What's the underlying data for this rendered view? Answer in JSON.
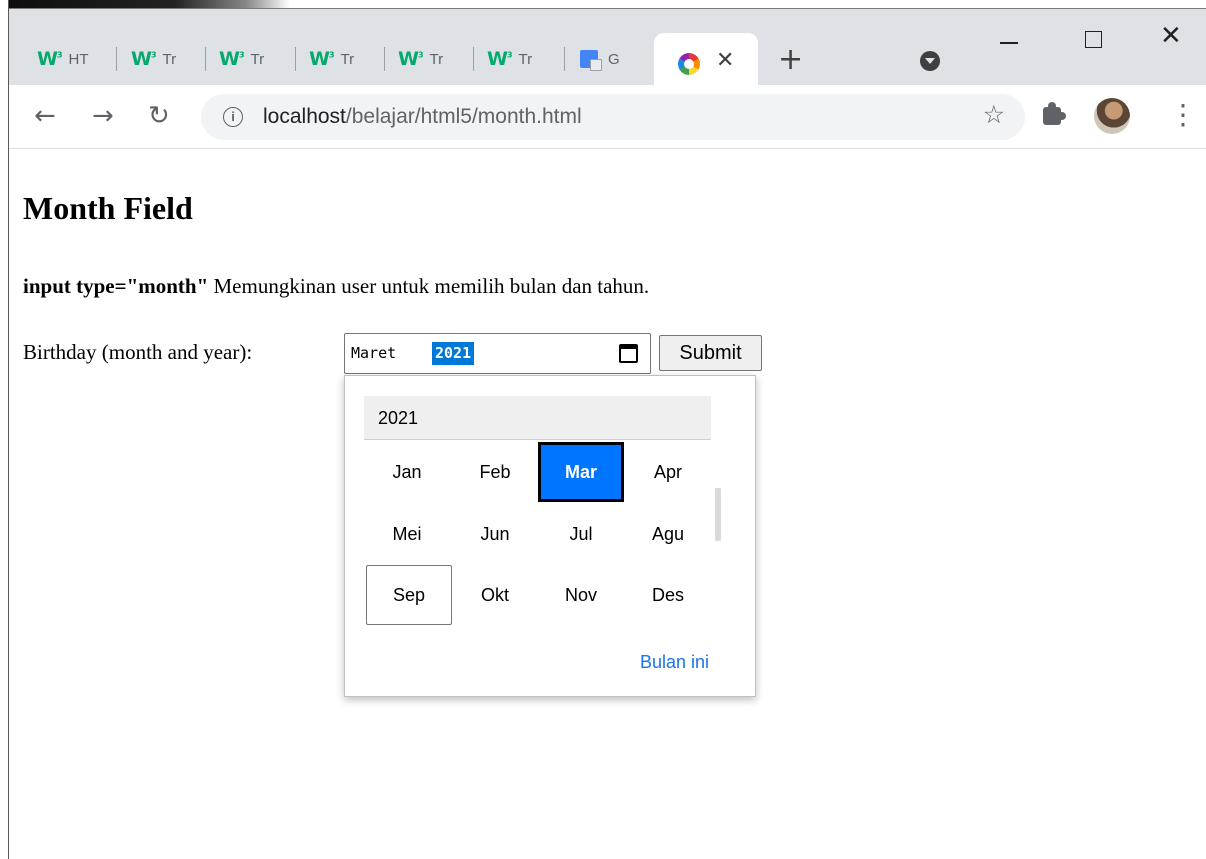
{
  "browser": {
    "tabs": [
      {
        "label": "HT"
      },
      {
        "label": "Tr"
      },
      {
        "label": "Tr"
      },
      {
        "label": "Tr"
      },
      {
        "label": "Tr"
      },
      {
        "label": "Tr"
      },
      {
        "label": "G"
      }
    ],
    "w3_mark": "W",
    "w3_sup": "3",
    "active_tab_close": "✕",
    "new_tab": "+",
    "url_host": "localhost",
    "url_path": "/belajar/html5/month.html",
    "info_glyph": "i",
    "star_glyph": "☆",
    "back_glyph": "←",
    "forward_glyph": "→",
    "reload_glyph": "↻",
    "menu_glyph": "⋮",
    "window_close_glyph": "✕"
  },
  "page": {
    "heading": "Month Field",
    "desc_bold": "input type=\"month\"",
    "desc_rest": " Memungkinan user untuk memilih bulan dan tahun.",
    "birthday_label": "Birthday (month and year):",
    "input_month": "Maret",
    "input_year": "2021",
    "submit_label": "Submit"
  },
  "picker": {
    "year": "2021",
    "months": [
      "Jan",
      "Feb",
      "Mar",
      "Apr",
      "Mei",
      "Jun",
      "Jul",
      "Agu",
      "Sep",
      "Okt",
      "Nov",
      "Des"
    ],
    "selected": "Mar",
    "current": "Sep",
    "this_month_label": "Bulan ini"
  },
  "colors": {
    "accent": "#0075ff",
    "selection": "#0078d7",
    "link": "#1a73e8",
    "w3_green": "#04aa6d"
  }
}
